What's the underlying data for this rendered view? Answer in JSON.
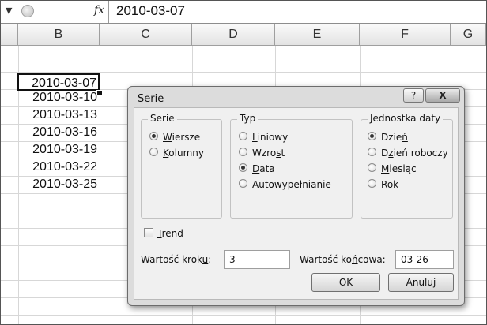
{
  "formula_bar": {
    "fx_symbol": "fx",
    "value": "2010-03-07"
  },
  "columns": [
    "B",
    "C",
    "D",
    "E",
    "F",
    "G"
  ],
  "cells": [
    "2010-03-07",
    "2010-03-10",
    "2010-03-13",
    "2010-03-16",
    "2010-03-19",
    "2010-03-22",
    "2010-03-25"
  ],
  "dialog": {
    "title": "Serie",
    "help": "?",
    "close": "X",
    "serie": {
      "legend": "Serie",
      "options": [
        {
          "pre": "",
          "u": "W",
          "post": "iersze",
          "selected": true
        },
        {
          "pre": "",
          "u": "K",
          "post": "olumny",
          "selected": false
        }
      ]
    },
    "typ": {
      "legend": "Typ",
      "options": [
        {
          "pre": "",
          "u": "L",
          "post": "iniowy",
          "selected": false
        },
        {
          "pre": "Wzro",
          "u": "s",
          "post": "t",
          "selected": false
        },
        {
          "pre": "",
          "u": "D",
          "post": "ata",
          "selected": true
        },
        {
          "pre": "Autowype",
          "u": "ł",
          "post": "nianie",
          "selected": false
        }
      ]
    },
    "jednostka": {
      "legend": "Jednostka daty",
      "options": [
        {
          "pre": "Dzie",
          "u": "ń",
          "post": "",
          "selected": true
        },
        {
          "pre": "D",
          "u": "z",
          "post": "ień roboczy",
          "selected": false
        },
        {
          "pre": "",
          "u": "M",
          "post": "iesiąc",
          "selected": false
        },
        {
          "pre": "",
          "u": "R",
          "post": "ok",
          "selected": false
        }
      ]
    },
    "trend": {
      "pre": "",
      "u": "T",
      "post": "rend",
      "checked": false
    },
    "krok": {
      "pre": "Wartość krok",
      "u": "u",
      "post": ":",
      "value": "3"
    },
    "koncowa": {
      "pre": "Wartość ko",
      "u": "ń",
      "post": "cowa:",
      "value": "03-26"
    },
    "ok_label": "OK",
    "cancel_label": "Anuluj"
  }
}
